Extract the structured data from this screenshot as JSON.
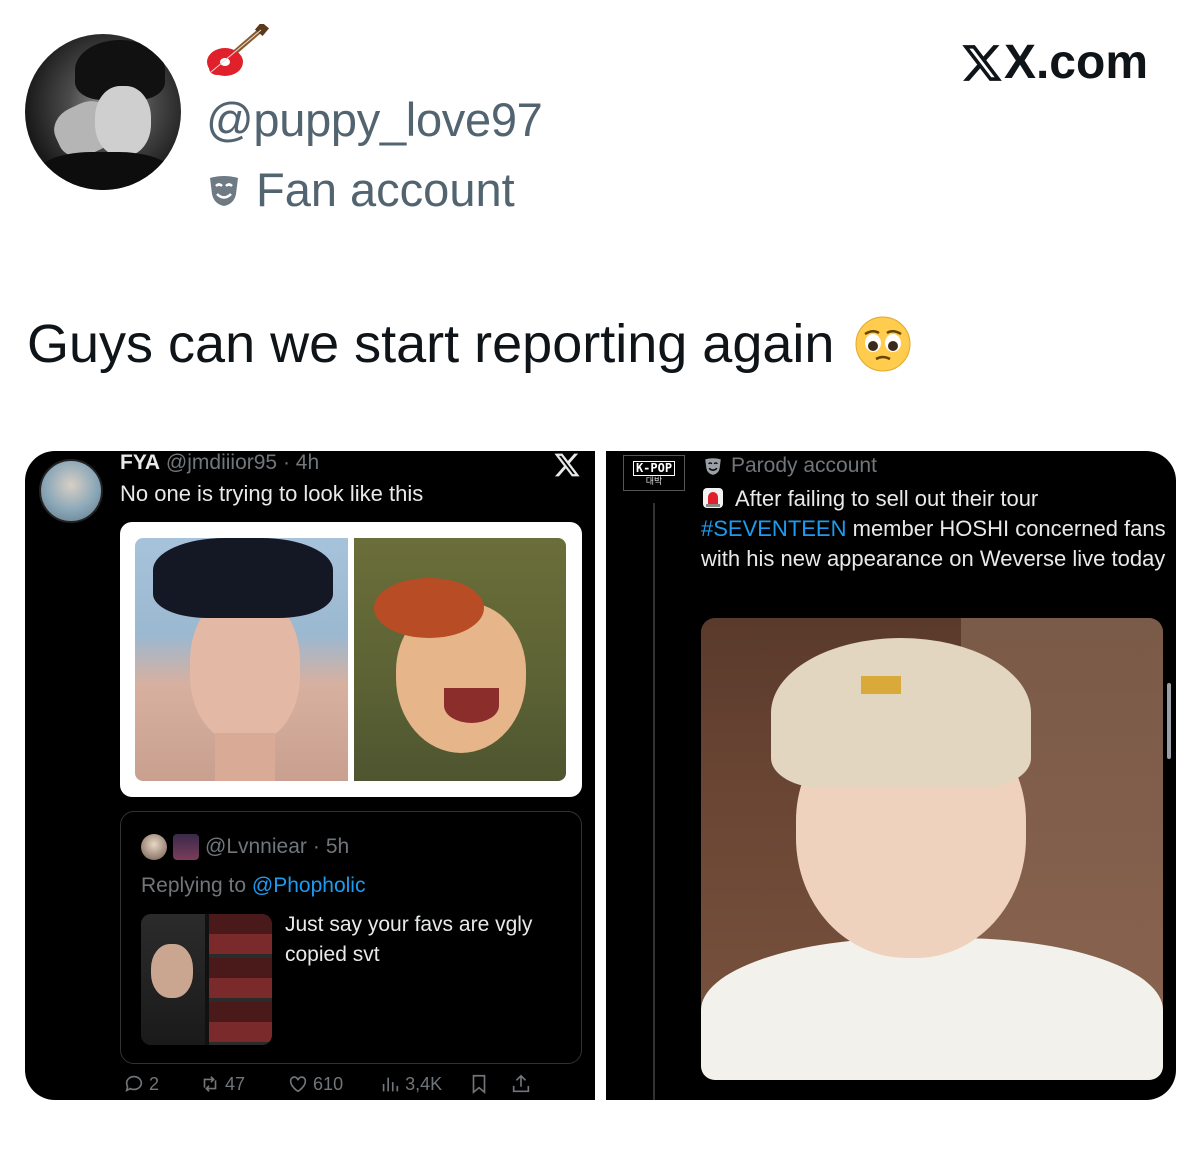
{
  "header": {
    "handle": "@puppy_love97",
    "account_label": "Fan account",
    "brand": "X.com"
  },
  "tweet": {
    "text": "Guys can we start reporting again"
  },
  "left_screenshot": {
    "author_name": "FYA",
    "author_handle": "@jmdiiior95",
    "age": "4h",
    "text": "No one is trying to look like this",
    "quote": {
      "handle": "@Lvnniear",
      "age": "5h",
      "replying_prefix": "Replying to",
      "replying_handle": "@Phopholic",
      "text": "Just say your favs are vgly copied svt"
    },
    "actions": {
      "replies": "2",
      "reposts": "47",
      "likes": "610",
      "views": "3,4K"
    }
  },
  "right_screenshot": {
    "avatar_text": "K-POP",
    "avatar_subtext": "대박",
    "account_label": "Parody account",
    "text_line1": "After failing to sell out their tour",
    "hashtag": "#SEVENTEEN",
    "text_line2": " member HOSHI concerned fans with his new appearance on Weverse live today"
  }
}
